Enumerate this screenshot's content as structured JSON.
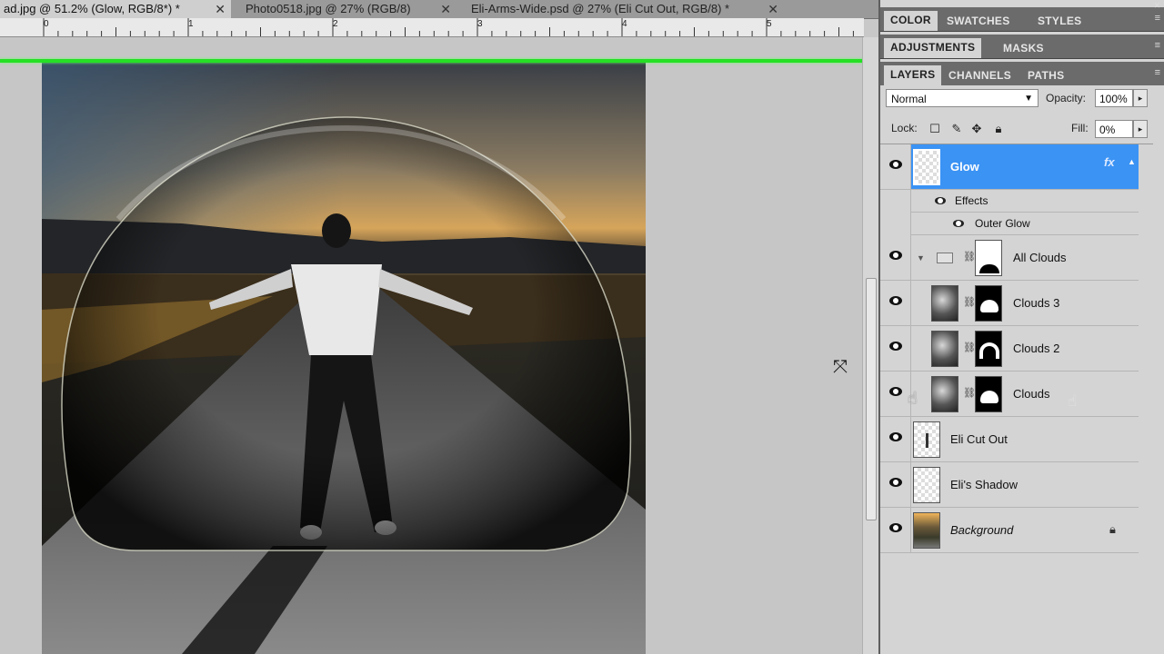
{
  "document_tabs": [
    {
      "label": "ad.jpg @ 51.2% (Glow, RGB/8*) *",
      "active": true
    },
    {
      "label": "Photo0518.jpg @ 27% (RGB/8)",
      "active": false
    },
    {
      "label": "Eli-Arms-Wide.psd @ 27% (Eli Cut Out, RGB/8) *",
      "active": false
    }
  ],
  "ruler_numbers": [
    "0",
    "1",
    "2",
    "3",
    "4",
    "5"
  ],
  "panel_tabs_row1": [
    "COLOR",
    "SWATCHES",
    "STYLES"
  ],
  "panel_tabs_row2": [
    "ADJUSTMENTS",
    "MASKS"
  ],
  "panel_tabs_row3": [
    "LAYERS",
    "CHANNELS",
    "PATHS"
  ],
  "layers_panel": {
    "blend_mode": "Normal",
    "opacity_label": "Opacity:",
    "opacity_value": "100%",
    "lock_label": "Lock:",
    "fill_label": "Fill:",
    "fill_value": "0%"
  },
  "layers": {
    "glow": {
      "name": "Glow",
      "fx": "fx"
    },
    "effects": "Effects",
    "outer_glow": "Outer Glow",
    "all_clouds": "All Clouds",
    "clouds3": "Clouds 3",
    "clouds2": "Clouds 2",
    "clouds": "Clouds",
    "eli_cut_out": "Eli Cut Out",
    "eli_shadow": "Eli's Shadow",
    "background": "Background"
  },
  "colors": {
    "selection": "#3b93f4",
    "guide": "#25e025",
    "panel_bg": "#d4d4d4",
    "panel_tab_bg": "#6b6b6b"
  },
  "icons": [
    "eye-icon",
    "chain-icon",
    "folder-icon",
    "padlock-icon",
    "fx-icon",
    "move-cursor-icon",
    "hand-cursor-icon"
  ]
}
